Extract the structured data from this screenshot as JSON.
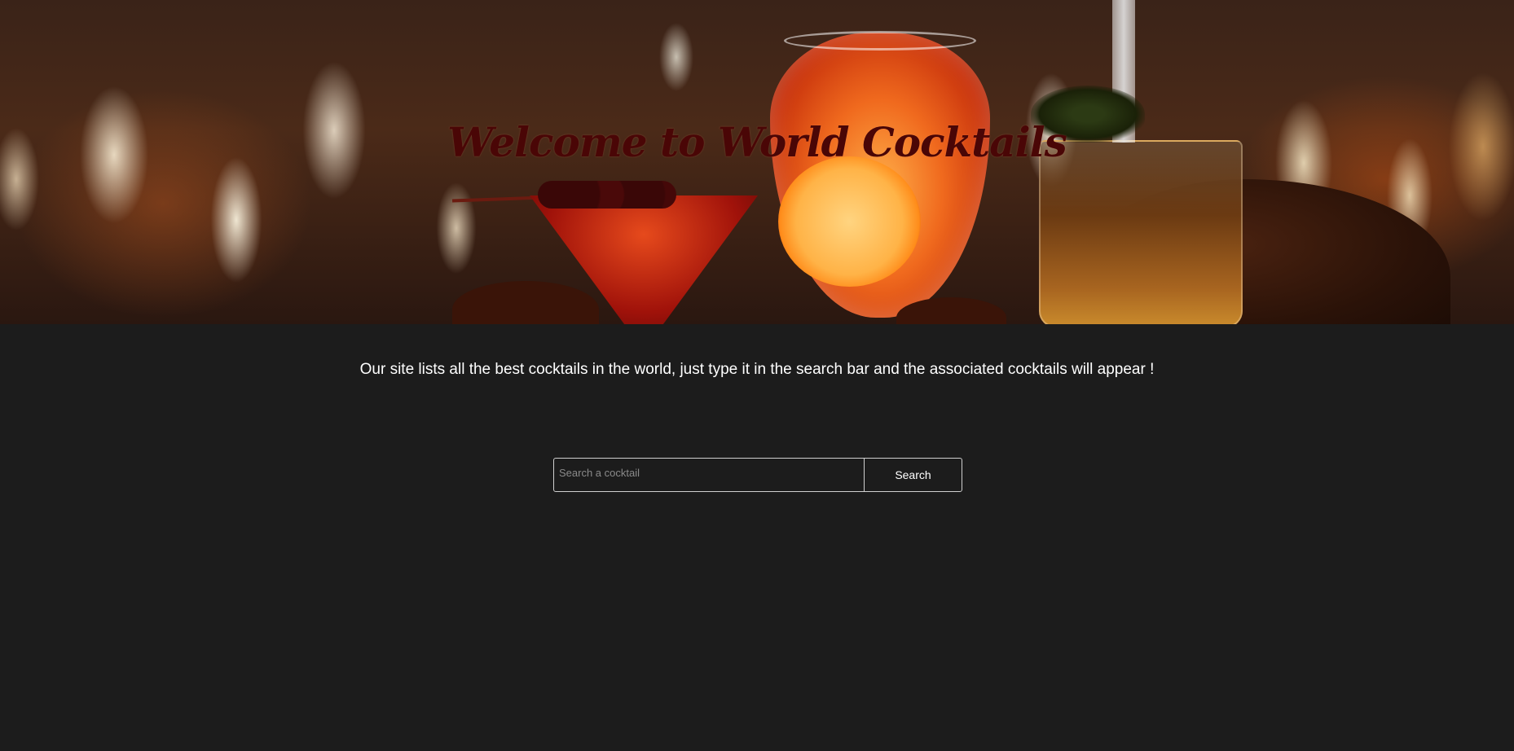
{
  "hero": {
    "title": "Welcome to World Cocktails",
    "image": "cocktail-glasses-bar-background"
  },
  "intro": {
    "text": "Our site lists all the best cocktails in the world, just type it in the search bar and the associated cocktails will appear !"
  },
  "search": {
    "placeholder": "Search a cocktail",
    "value": "",
    "button_label": "Search"
  },
  "colors": {
    "background": "#1c1c1c",
    "title": "#4a0606",
    "text": "#ffffff",
    "border": "#d0d0d0"
  }
}
